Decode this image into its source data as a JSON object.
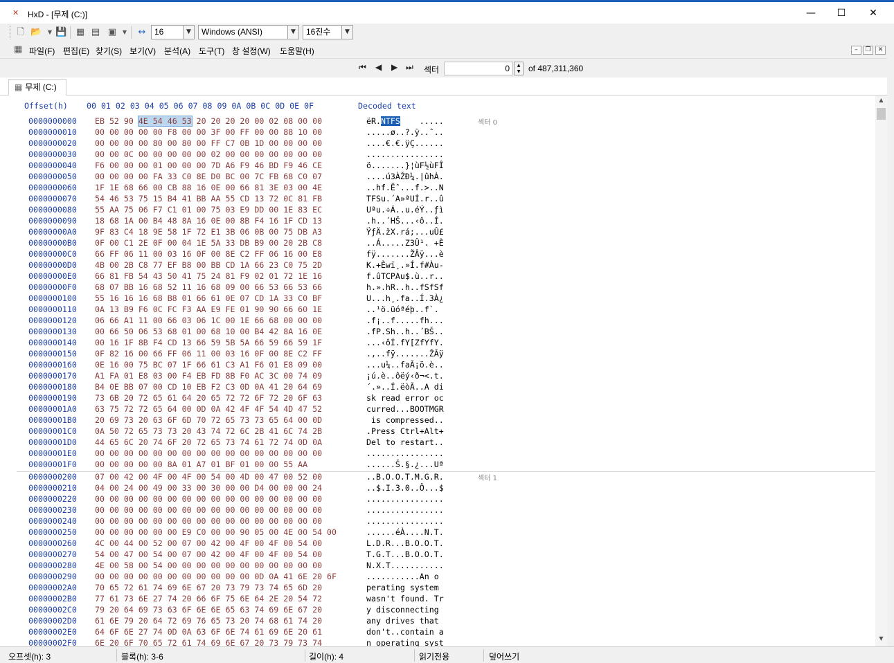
{
  "window": {
    "app_icon": "HxD",
    "title": "HxD - [무제 (C:)]",
    "minimize": "—",
    "maximize": "☐",
    "close": "✕"
  },
  "toolbar": {
    "bytes_per_row": "16",
    "charset": "Windows (ANSI)",
    "base": "16진수"
  },
  "menu": {
    "items": [
      "파일(F)",
      "편집(E)",
      "찾기(S)",
      "보기(V)",
      "분석(A)",
      "도구(T)",
      "창 설정(W)",
      "도움말(H)"
    ]
  },
  "nav": {
    "sector_label": "섹터",
    "sector_value": "0",
    "of_label": "of 487,311,360"
  },
  "tab": {
    "label": "무제 (C:)"
  },
  "hex": {
    "header_offset": "Offset(h)",
    "header_columns": "00 01 02 03 04 05 06 07 08 09 0A 0B 0C 0D 0E 0F",
    "header_decoded": "Decoded text",
    "sector0_label": "섹터 0",
    "sector1_label": "섹터 1",
    "rows": [
      {
        "o": "0000000000",
        "h": "EB 52 90 4E 54 46 53 20 20 20 20 00 02 08 00 00",
        "t": "ëR.NTFS    ....."
      },
      {
        "o": "0000000010",
        "h": "00 00 00 00 00 F8 00 00 3F 00 FF 00 00 88 10 00",
        "t": ".....ø..?.ÿ..ˆ.."
      },
      {
        "o": "0000000020",
        "h": "00 00 00 00 80 00 80 00 FF C7 0B 1D 00 00 00 00",
        "t": "....€.€.ÿÇ......"
      },
      {
        "o": "0000000030",
        "h": "00 00 0C 00 00 00 00 00 02 00 00 00 00 00 00 00",
        "t": "................"
      },
      {
        "o": "0000000040",
        "h": "F6 00 00 00 01 00 00 00 7D A6 F9 46 BD F9 46 CE",
        "t": "ö.......}¦ùF½ùFÎ"
      },
      {
        "o": "0000000050",
        "h": "00 00 00 00 FA 33 C0 8E D0 BC 00 7C FB 68 C0 07",
        "t": "....ú3ÀŽÐ¼.|ûhÀ."
      },
      {
        "o": "0000000060",
        "h": "1F 1E 68 66 00 CB 88 16 0E 00 66 81 3E 03 00 4E",
        "t": "..hf.Ëˆ...f.>..N"
      },
      {
        "o": "0000000070",
        "h": "54 46 53 75 15 B4 41 BB AA 55 CD 13 72 0C 81 FB",
        "t": "TFSu.´A»ªUÍ.r..û"
      },
      {
        "o": "0000000080",
        "h": "55 AA 75 06 F7 C1 01 00 75 03 E9 DD 00 1E 83 EC",
        "t": "Uªu.÷Á..u.éÝ..ƒì"
      },
      {
        "o": "0000000090",
        "h": "18 68 1A 00 B4 48 8A 16 0E 00 8B F4 16 1F CD 13",
        "t": ".h..´HŠ...‹ô..Í."
      },
      {
        "o": "00000000A0",
        "h": "9F 83 C4 18 9E 58 1F 72 E1 3B 06 0B 00 75 DB A3",
        "t": "ŸƒÄ.žX.rá;...uÛ£"
      },
      {
        "o": "00000000B0",
        "h": "0F 00 C1 2E 0F 00 04 1E 5A 33 DB B9 00 20 2B C8",
        "t": "..Á.....Z3Û¹. +È"
      },
      {
        "o": "00000000C0",
        "h": "66 FF 06 11 00 03 16 0F 00 8E C2 FF 06 16 00 E8",
        "t": "fÿ.......ŽÂÿ...è"
      },
      {
        "o": "00000000D0",
        "h": "4B 00 2B C8 77 EF B8 00 BB CD 1A 66 23 C0 75 2D",
        "t": "K.+Èwï¸.»Í.f#Àu-"
      },
      {
        "o": "00000000E0",
        "h": "66 81 FB 54 43 50 41 75 24 81 F9 02 01 72 1E 16",
        "t": "f.ûTCPAu$.ù..r.."
      },
      {
        "o": "00000000F0",
        "h": "68 07 BB 16 68 52 11 16 68 09 00 66 53 66 53 66",
        "t": "h.».hR..h..fSfSf"
      },
      {
        "o": "0000000100",
        "h": "55 16 16 16 68 B8 01 66 61 0E 07 CD 1A 33 C0 BF",
        "t": "U...h¸.fa..Í.3À¿"
      },
      {
        "o": "0000000110",
        "h": "0A 13 B9 F6 0C FC F3 AA E9 FE 01 90 90 66 60 1E",
        "t": "..¹ö.üóªéþ..f`."
      },
      {
        "o": "0000000120",
        "h": "06 66 A1 11 00 66 03 06 1C 00 1E 66 68 00 00 00",
        "t": ".f¡..f.....fh..."
      },
      {
        "o": "0000000130",
        "h": "00 66 50 06 53 68 01 00 68 10 00 B4 42 8A 16 0E",
        "t": ".fP.Sh..h..´BŠ.."
      },
      {
        "o": "0000000140",
        "h": "00 16 1F 8B F4 CD 13 66 59 5B 5A 66 59 66 59 1F",
        "t": "...‹ôÍ.fY[ZfYfY."
      },
      {
        "o": "0000000150",
        "h": "0F 82 16 00 66 FF 06 11 00 03 16 0F 00 8E C2 FF",
        "t": ".‚..fÿ.......ŽÂÿ"
      },
      {
        "o": "0000000160",
        "h": "0E 16 00 75 BC 07 1F 66 61 C3 A1 F6 01 E8 09 00",
        "t": "...u¼..faÃ¡ö.è.."
      },
      {
        "o": "0000000170",
        "h": "A1 FA 01 E8 03 00 F4 EB FD 8B F0 AC 3C 00 74 09",
        "t": "¡ú.è..ôëý‹ð¬<.t."
      },
      {
        "o": "0000000180",
        "h": "B4 0E BB 07 00 CD 10 EB F2 C3 0D 0A 41 20 64 69",
        "t": "´.»..Í.ëòÃ..A di"
      },
      {
        "o": "0000000190",
        "h": "73 6B 20 72 65 61 64 20 65 72 72 6F 72 20 6F 63",
        "t": "sk read error oc"
      },
      {
        "o": "00000001A0",
        "h": "63 75 72 72 65 64 00 0D 0A 42 4F 4F 54 4D 47 52",
        "t": "curred...BOOTMGR"
      },
      {
        "o": "00000001B0",
        "h": "20 69 73 20 63 6F 6D 70 72 65 73 73 65 64 00 0D",
        "t": " is compressed.."
      },
      {
        "o": "00000001C0",
        "h": "0A 50 72 65 73 73 20 43 74 72 6C 2B 41 6C 74 2B",
        "t": ".Press Ctrl+Alt+"
      },
      {
        "o": "00000001D0",
        "h": "44 65 6C 20 74 6F 20 72 65 73 74 61 72 74 0D 0A",
        "t": "Del to restart.."
      },
      {
        "o": "00000001E0",
        "h": "00 00 00 00 00 00 00 00 00 00 00 00 00 00 00 00",
        "t": "................"
      },
      {
        "o": "00000001F0",
        "h": "00 00 00 00 00 8A 01 A7 01 BF 01 00 00 55 AA",
        "t": "......Š.§.¿...Uª"
      },
      {
        "o": "0000000200",
        "h": "07 00 42 00 4F 00 4F 00 54 00 4D 00 47 00 52 00",
        "t": "..B.O.O.T.M.G.R."
      },
      {
        "o": "0000000210",
        "h": "04 00 24 00 49 00 33 00 30 00 00 D4 00 00 00 24",
        "t": "..$.I.3.0..Ô...$"
      },
      {
        "o": "0000000220",
        "h": "00 00 00 00 00 00 00 00 00 00 00 00 00 00 00 00",
        "t": "................"
      },
      {
        "o": "0000000230",
        "h": "00 00 00 00 00 00 00 00 00 00 00 00 00 00 00 00",
        "t": "................"
      },
      {
        "o": "0000000240",
        "h": "00 00 00 00 00 00 00 00 00 00 00 00 00 00 00 00",
        "t": "................"
      },
      {
        "o": "0000000250",
        "h": "00 00 00 00 00 00 E9 C0 00 00 90 05 00 4E 00 54 00",
        "t": "......éÀ....N.T."
      },
      {
        "o": "0000000260",
        "h": "4C 00 44 00 52 00 07 00 42 00 4F 00 4F 00 54 00",
        "t": "L.D.R...B.O.O.T."
      },
      {
        "o": "0000000270",
        "h": "54 00 47 00 54 00 07 00 42 00 4F 00 4F 00 54 00",
        "t": "T.G.T...B.O.O.T."
      },
      {
        "o": "0000000280",
        "h": "4E 00 58 00 54 00 00 00 00 00 00 00 00 00 00 00",
        "t": "N.X.T..........."
      },
      {
        "o": "0000000290",
        "h": "00 00 00 00 00 00 00 00 00 00 00 0D 0A 41 6E 20 6F",
        "t": "...........An o"
      },
      {
        "o": "00000002A0",
        "h": "70 65 72 61 74 69 6E 67 20 73 79 73 74 65 6D 20",
        "t": "perating system "
      },
      {
        "o": "00000002B0",
        "h": "77 61 73 6E 27 74 20 66 6F 75 6E 64 2E 20 54 72",
        "t": "wasn't found. Tr"
      },
      {
        "o": "00000002C0",
        "h": "79 20 64 69 73 63 6F 6E 6E 65 63 74 69 6E 67 20",
        "t": "y disconnecting "
      },
      {
        "o": "00000002D0",
        "h": "61 6E 79 20 64 72 69 76 65 73 20 74 68 61 74 20",
        "t": "any drives that "
      },
      {
        "o": "00000002E0",
        "h": "64 6F 6E 27 74 0D 0A 63 6F 6E 74 61 69 6E 20 61",
        "t": "don't..contain a"
      },
      {
        "o": "00000002F0",
        "h": "6E 20 6F 70 65 72 61 74 69 6E 67 20 73 79 73 74",
        "t": "n operating syst"
      }
    ]
  },
  "status": {
    "offset": "오프셋(h): 3",
    "block": "블록(h): 3-6",
    "length": "길이(h): 4",
    "readonly": "읽기전용",
    "overwrite": "덮어쓰기"
  },
  "icons": [
    "new-file-icon",
    "open-file-icon",
    "save-icon",
    "disk-icon",
    "ram-icon",
    "properties-icon",
    "first-icon",
    "prev-icon",
    "next-icon",
    "last-icon"
  ]
}
